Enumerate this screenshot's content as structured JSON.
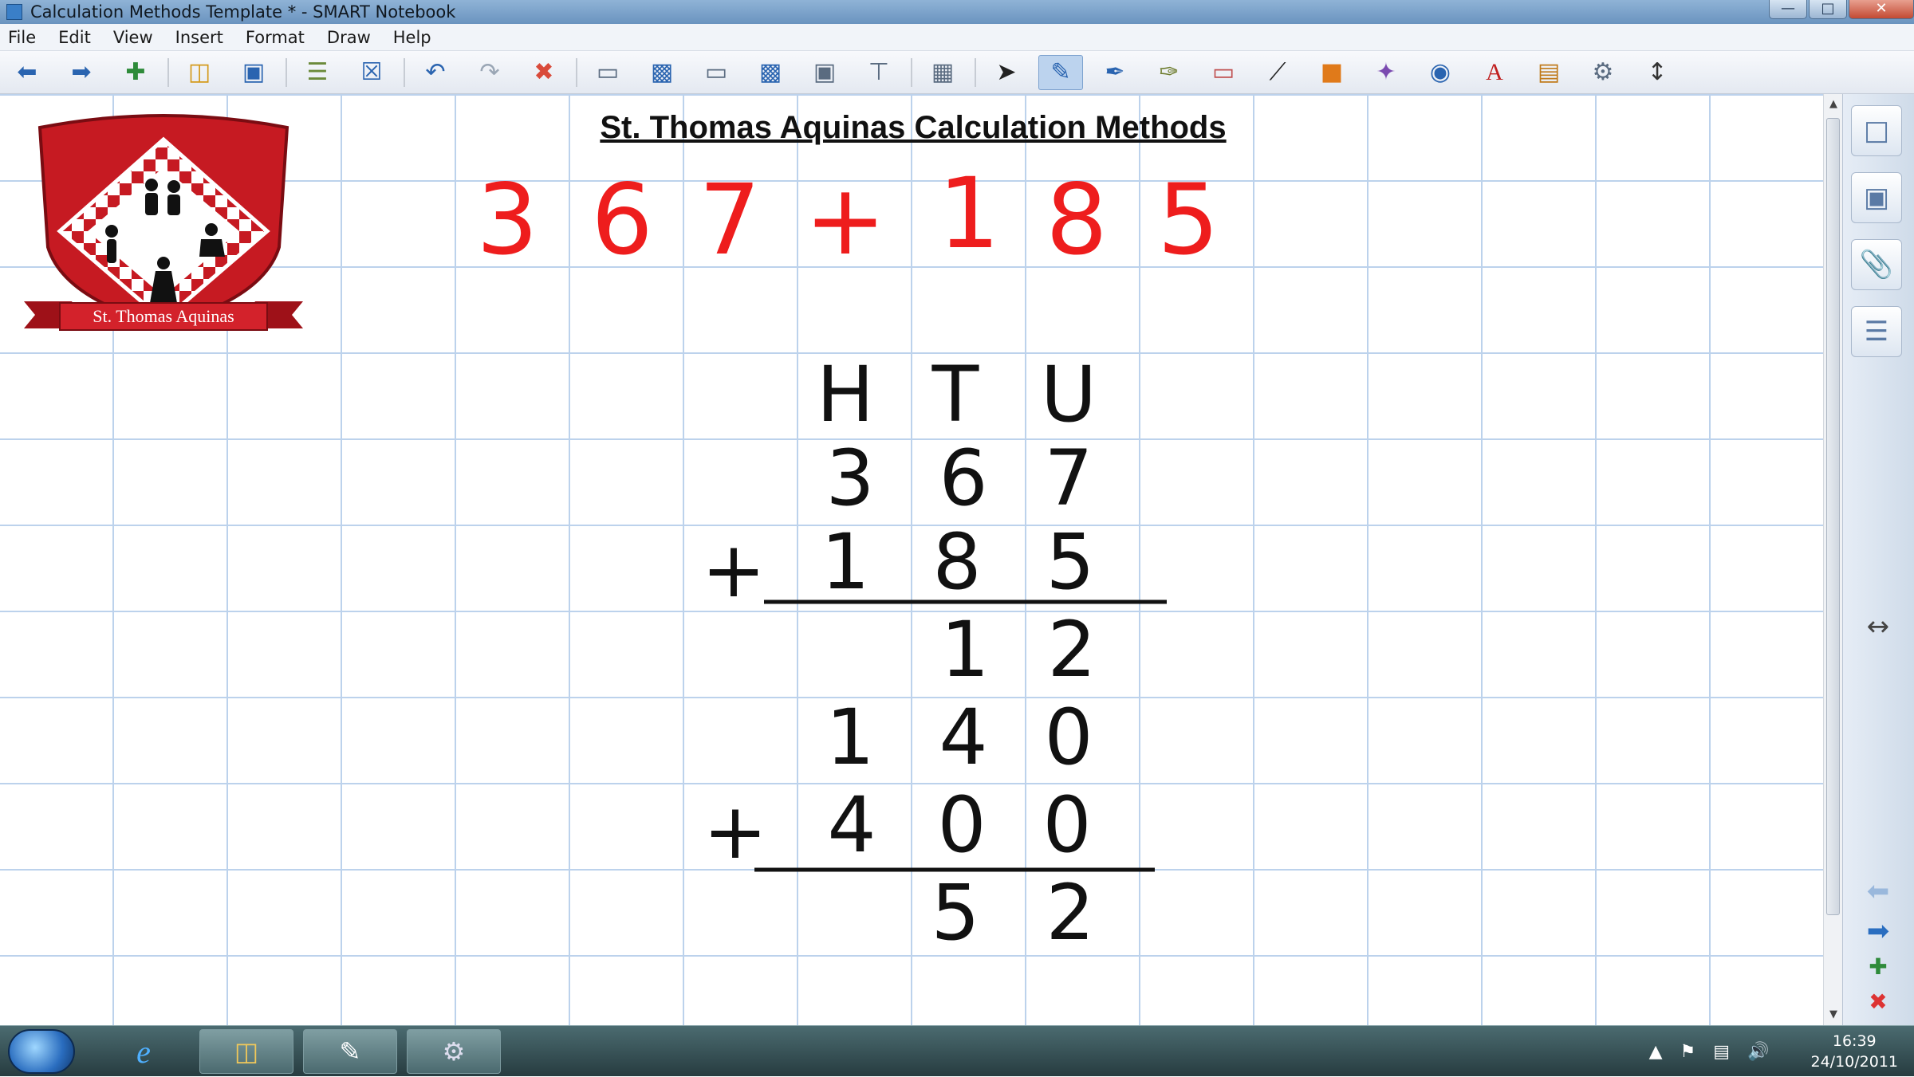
{
  "window": {
    "title": "Calculation Methods Template * - SMART Notebook",
    "min_icon": "minimize-icon",
    "max_icon": "maximize-icon",
    "close_icon": "close-icon"
  },
  "menu": [
    "File",
    "Edit",
    "View",
    "Insert",
    "Format",
    "Draw",
    "Help"
  ],
  "toolbar": {
    "icons": [
      "back-arrow-icon",
      "forward-arrow-icon",
      "add-page-icon",
      "open-folder-icon",
      "save-icon",
      "paste-icon",
      "clear-page-icon",
      "undo-icon",
      "redo-icon",
      "delete-icon",
      "screen-shade-icon",
      "show-hide-screen-icon",
      "dual-page-icon",
      "full-screen-icon",
      "capture-icon",
      "document-camera-icon",
      "table-icon",
      "select-icon",
      "pen-icon",
      "creative-pen-icon",
      "highlighter-icon",
      "eraser-icon",
      "line-icon",
      "shapes-icon",
      "magic-pen-icon",
      "fill-icon",
      "text-icon",
      "properties-icon",
      "toolbar-customize-icon",
      "move-toolbar-icon"
    ],
    "active": "pen-icon"
  },
  "page": {
    "title": "St. Thomas Aquinas Calculation Methods",
    "crest_banner": "St. Thomas Aquinas",
    "equation": [
      "3",
      "6",
      "7",
      "+",
      "1",
      "8",
      "5"
    ],
    "headers": [
      "H",
      "T",
      "U"
    ],
    "row1": [
      "3",
      "6",
      "7"
    ],
    "row2_sign": "+",
    "row2": [
      "1",
      "8",
      "5"
    ],
    "partial1": [
      "1",
      "2"
    ],
    "partial2": [
      "1",
      "4",
      "0"
    ],
    "partial3_sign": "+",
    "partial3": [
      "4",
      "0",
      "0"
    ],
    "result": [
      "5",
      "2"
    ]
  },
  "sidepanel": {
    "tabs": [
      "page-sorter-icon",
      "gallery-icon",
      "attachments-icon",
      "properties-tab-icon"
    ],
    "resize_icon": "resize-horizontal-icon",
    "nav_icons": [
      "previous-page-icon",
      "next-page-icon",
      "add-page-side-icon",
      "delete-page-side-icon"
    ]
  },
  "taskbar": {
    "apps": [
      "internet-explorer-icon",
      "file-explorer-icon",
      "smart-notebook-icon",
      "smart-tools-icon"
    ],
    "time": "16:39",
    "date": "24/10/2011"
  }
}
